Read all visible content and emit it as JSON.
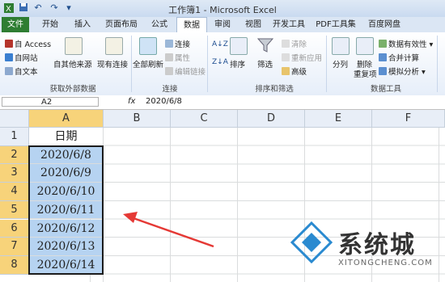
{
  "window": {
    "title": "工作簿1 - Microsoft Excel"
  },
  "quick_access": [
    "save-icon",
    "undo-icon",
    "redo-icon",
    "customize-icon"
  ],
  "tabs": [
    {
      "label": "文件"
    },
    {
      "label": "开始"
    },
    {
      "label": "插入"
    },
    {
      "label": "页面布局"
    },
    {
      "label": "公式"
    },
    {
      "label": "数据"
    },
    {
      "label": "审阅"
    },
    {
      "label": "视图"
    },
    {
      "label": "开发工具"
    },
    {
      "label": "PDF工具集"
    },
    {
      "label": "百度网盘"
    }
  ],
  "active_tab": "数据",
  "ribbon": {
    "external": {
      "access": "自 Access",
      "web": "自网站",
      "text": "自文本",
      "other": "自其他来源",
      "existing": "现有连接",
      "group": "获取外部数据"
    },
    "connections": {
      "refresh": "全部刷新",
      "conn": "连接",
      "props": "属性",
      "edit_links": "编辑链接",
      "group": "连接"
    },
    "sort_filter": {
      "sort": "排序",
      "filter": "筛选",
      "clear": "清除",
      "reapply": "重新应用",
      "advanced": "高级",
      "group": "排序和筛选"
    },
    "data_tools": {
      "split": "分列",
      "remove_dup_1": "删除",
      "remove_dup_2": "重复项",
      "validation": "数据有效性",
      "consolidate": "合并计算",
      "whatif": "模拟分析",
      "group": "数据工具"
    }
  },
  "formula_bar": {
    "name_box": "A2",
    "fx": "fx",
    "value": "2020/6/8"
  },
  "columns": [
    "A",
    "B",
    "C",
    "D",
    "E",
    "F"
  ],
  "rows": [
    "1",
    "2",
    "3",
    "4",
    "5",
    "6",
    "7",
    "8"
  ],
  "cells": {
    "a1": "日期",
    "dates": [
      "2020/6/8",
      "2020/6/9",
      "2020/6/10",
      "2020/6/11",
      "2020/6/12",
      "2020/6/13",
      "2020/6/14"
    ]
  },
  "watermark": {
    "text": "系统城",
    "sub": "XITONGCHENG.COM"
  },
  "colors": {
    "accent": "#2e7d32",
    "selection": "#b6d3f1",
    "arrow": "#e53935"
  }
}
